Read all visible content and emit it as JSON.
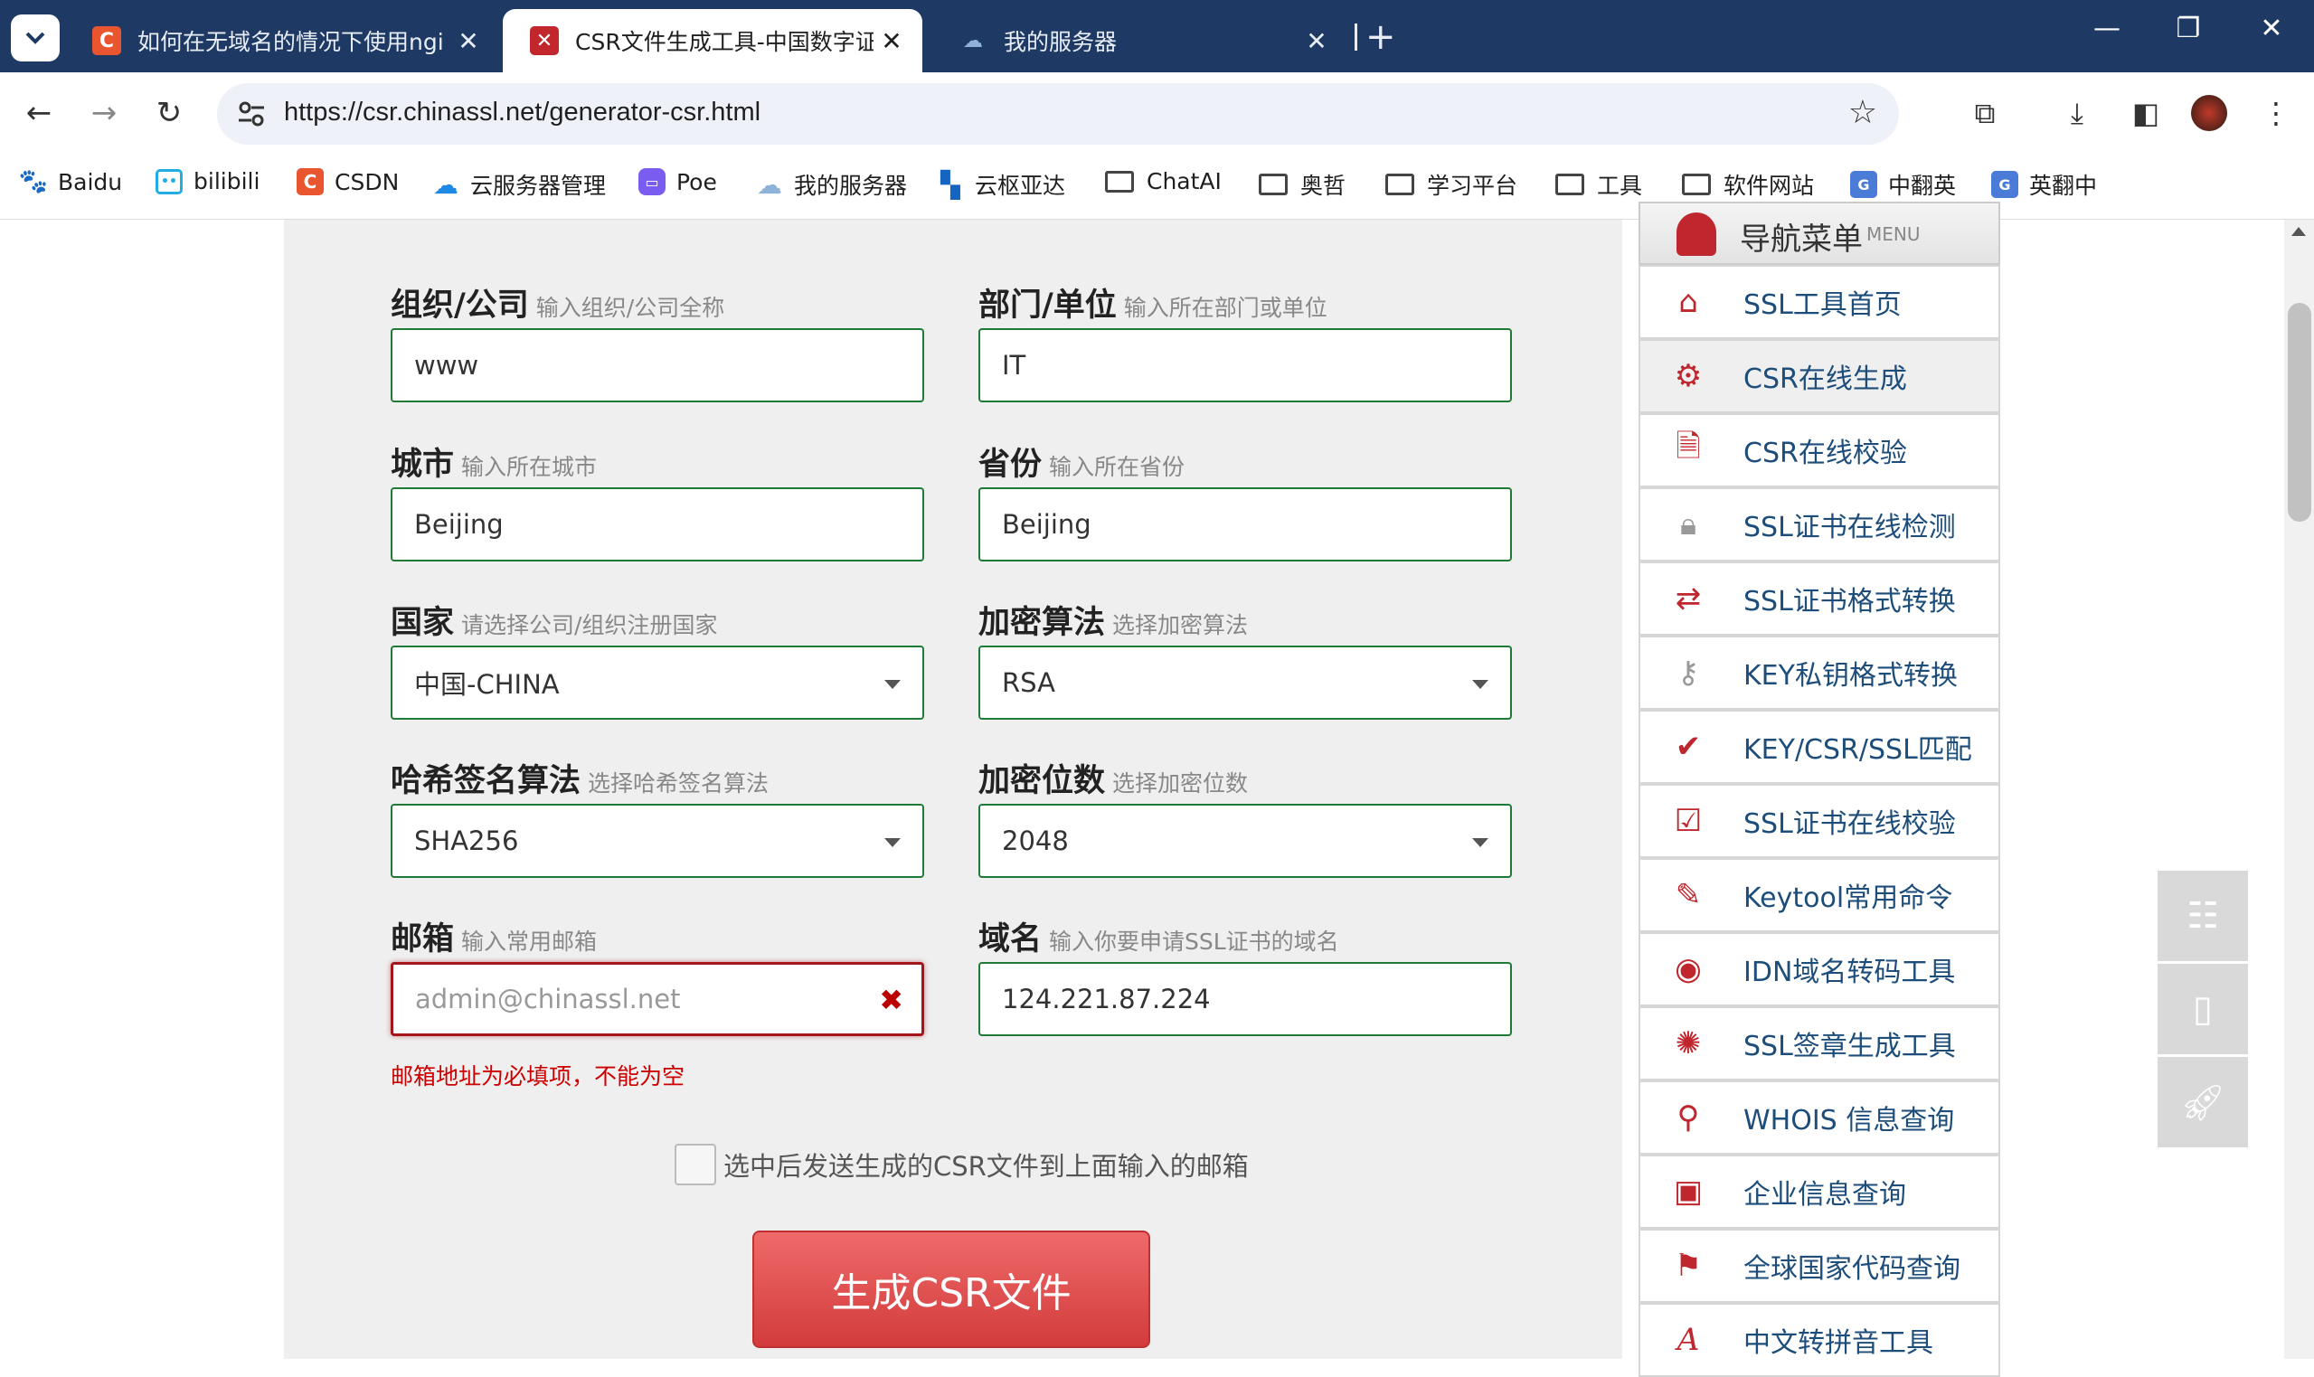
{
  "browser": {
    "tabs": [
      {
        "title": "如何在无域名的情况下使用ngi",
        "favicon": "csdn-icon",
        "active": false
      },
      {
        "title": "CSR文件生成工具-中国数字证书",
        "favicon": "chinassl-icon",
        "active": true
      },
      {
        "title": "我的服务器",
        "favicon": "server-icon",
        "active": false
      }
    ],
    "url": "https://csr.chinassl.net/generator-csr.html",
    "bookmarks": [
      {
        "label": "Baidu",
        "icon": "baidu-icon"
      },
      {
        "label": "bilibili",
        "icon": "bilibili-icon"
      },
      {
        "label": "CSDN",
        "icon": "csdn-icon"
      },
      {
        "label": "云服务器管理",
        "icon": "cloud-icon"
      },
      {
        "label": "Poe",
        "icon": "poe-icon"
      },
      {
        "label": "我的服务器",
        "icon": "server-icon"
      },
      {
        "label": "云枢亚达",
        "icon": "bookmark-icon"
      },
      {
        "label": "ChatAI",
        "icon": "folder-icon"
      },
      {
        "label": "奥哲",
        "icon": "folder-icon"
      },
      {
        "label": "学习平台",
        "icon": "folder-icon"
      },
      {
        "label": "工具",
        "icon": "folder-icon"
      },
      {
        "label": "软件网站",
        "icon": "folder-icon"
      },
      {
        "label": "中翻英",
        "icon": "translate-icon"
      },
      {
        "label": "英翻中",
        "icon": "translate-icon"
      }
    ]
  },
  "form": {
    "org": {
      "label": "组织/公司",
      "hint": "输入组织/公司全称",
      "value": "www"
    },
    "dept": {
      "label": "部门/单位",
      "hint": "输入所在部门或单位",
      "value": "IT"
    },
    "city": {
      "label": "城市",
      "hint": "输入所在城市",
      "value": "Beijing"
    },
    "province": {
      "label": "省份",
      "hint": "输入所在省份",
      "value": "Beijing"
    },
    "country": {
      "label": "国家",
      "hint": "请选择公司/组织注册国家",
      "value": "中国-CHINA"
    },
    "algo": {
      "label": "加密算法",
      "hint": "选择加密算法",
      "value": "RSA"
    },
    "hash": {
      "label": "哈希签名算法",
      "hint": "选择哈希签名算法",
      "value": "SHA256"
    },
    "bits": {
      "label": "加密位数",
      "hint": "选择加密位数",
      "value": "2048"
    },
    "email": {
      "label": "邮箱",
      "hint": "输入常用邮箱",
      "placeholder": "admin@chinassl.net",
      "error": "邮箱地址为必填项，不能为空"
    },
    "domain": {
      "label": "域名",
      "hint": "输入你要申请SSL证书的域名",
      "value": "124.221.87.224"
    },
    "send_email_label": "选中后发送生成的CSR文件到上面输入的邮箱",
    "submit_label": "生成CSR文件"
  },
  "menu": {
    "title": "导航菜单",
    "subtitle": "MENU",
    "items": [
      {
        "label": "SSL工具首页",
        "icon": "home-icon"
      },
      {
        "label": "CSR在线生成",
        "icon": "gear-icon",
        "active": true
      },
      {
        "label": "CSR在线校验",
        "icon": "document-gear-icon"
      },
      {
        "label": "SSL证书在线检测",
        "icon": "lock-icon"
      },
      {
        "label": "SSL证书格式转换",
        "icon": "convert-icon"
      },
      {
        "label": "KEY私钥格式转换",
        "icon": "key-icon"
      },
      {
        "label": "KEY/CSR/SSL匹配",
        "icon": "checkmark-icon"
      },
      {
        "label": "SSL证书在线校验",
        "icon": "certificate-check-icon"
      },
      {
        "label": "Keytool常用命令",
        "icon": "wrench-icon"
      },
      {
        "label": "IDN域名转码工具",
        "icon": "globe-icon"
      },
      {
        "label": "SSL签章生成工具",
        "icon": "seal-icon"
      },
      {
        "label": "WHOIS 信息查询",
        "icon": "magnifier-icon"
      },
      {
        "label": "企业信息查询",
        "icon": "briefcase-icon"
      },
      {
        "label": "全球国家代码查询",
        "icon": "flag-icon"
      },
      {
        "label": "中文转拼音工具",
        "icon": "pinyin-icon"
      }
    ]
  },
  "colors": {
    "accent": "#1e7a34",
    "error": "#a4161a",
    "button": "#d9464a",
    "titlebar": "#1e3a64",
    "menu_text": "#1d4d7a"
  }
}
